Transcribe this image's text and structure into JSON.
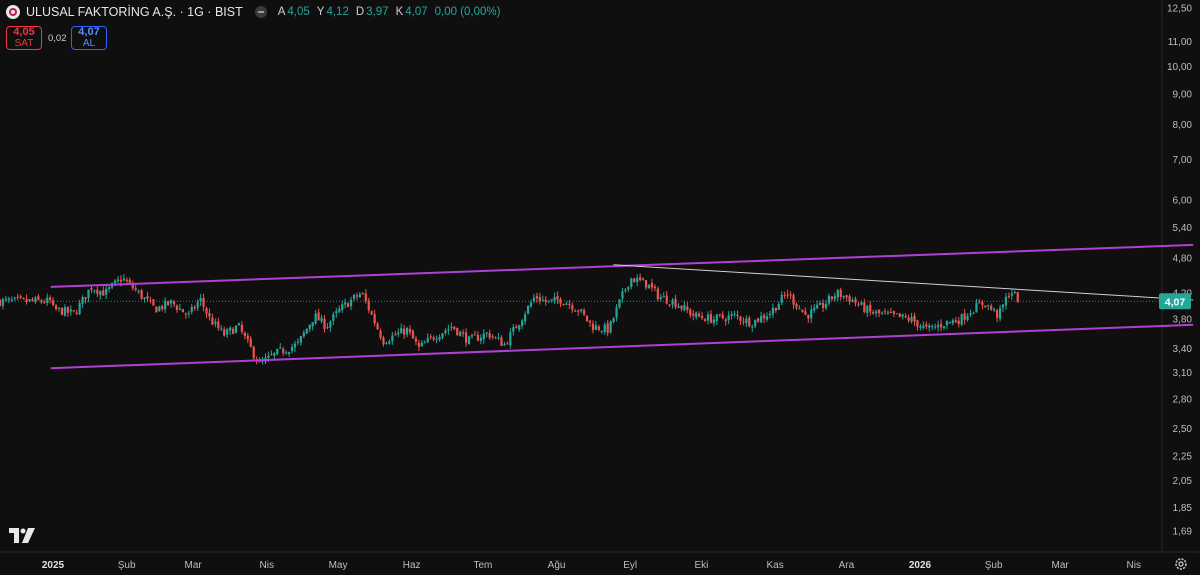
{
  "header": {
    "symbol_title": "ULUSAL FAKTORİNG A.Ş. · 1G · BIST",
    "open_label": "A",
    "open_value": "4,05",
    "high_label": "Y",
    "high_value": "4,12",
    "low_label": "D",
    "low_value": "3,97",
    "close_label": "K",
    "close_value": "4,07",
    "change": "0,00 (0,00%)"
  },
  "trade": {
    "sell_price": "4,05",
    "sell_label": "SAT",
    "spread": "0,02",
    "buy_price": "4,07",
    "buy_label": "AL"
  },
  "colors": {
    "background": "#0f0f0f",
    "up": "#26a69a",
    "down": "#ef5350",
    "channel": "#b13fd6",
    "trendline": "#d0d0d0",
    "price_tag": "#26a69a"
  },
  "chart_data": {
    "type": "candlestick",
    "scale": "log",
    "ylim": [
      1.6,
      12.8
    ],
    "y_ticks": [
      "12,50",
      "11,00",
      "10,00",
      "9,00",
      "8,00",
      "7,00",
      "6,00",
      "5,40",
      "4,80",
      "4,20",
      "3,80",
      "3,40",
      "3,10",
      "2,80",
      "2,50",
      "2,25",
      "2,05",
      "1,85",
      "1,69"
    ],
    "x_ticks": [
      "2025",
      "Şub",
      "Mar",
      "Nis",
      "May",
      "Haz",
      "Tem",
      "Ağu",
      "Eyl",
      "Eki",
      "Kas",
      "Ara",
      "2026",
      "Şub",
      "Mar",
      "Nis"
    ],
    "x_ticks_bold": [
      "2025",
      "2026"
    ],
    "last_price": "4,07",
    "last_price_value": 4.07,
    "price_path": [
      [
        "2025-01-01",
        3.95
      ],
      [
        "2025-01-10",
        3.88
      ],
      [
        "2025-01-17",
        4.3
      ],
      [
        "2025-01-23",
        4.2
      ],
      [
        "2025-01-30",
        4.45
      ],
      [
        "2025-02-06",
        4.2
      ],
      [
        "2025-02-13",
        3.95
      ],
      [
        "2025-02-20",
        4.05
      ],
      [
        "2025-02-27",
        3.85
      ],
      [
        "2025-03-04",
        4.1
      ],
      [
        "2025-03-08",
        3.8
      ],
      [
        "2025-03-14",
        3.58
      ],
      [
        "2025-03-20",
        3.7
      ],
      [
        "2025-03-26",
        3.35
      ],
      [
        "2025-03-29",
        3.2
      ],
      [
        "2025-04-06",
        3.35
      ],
      [
        "2025-04-14",
        3.45
      ],
      [
        "2025-04-21",
        3.85
      ],
      [
        "2025-04-26",
        3.7
      ],
      [
        "2025-05-02",
        3.95
      ],
      [
        "2025-05-07",
        4.1
      ],
      [
        "2025-05-11",
        4.2
      ],
      [
        "2025-05-20",
        3.5
      ],
      [
        "2025-05-30",
        3.65
      ],
      [
        "2025-06-04",
        3.4
      ],
      [
        "2025-06-10",
        3.55
      ],
      [
        "2025-06-18",
        3.7
      ],
      [
        "2025-06-25",
        3.5
      ],
      [
        "2025-07-03",
        3.6
      ],
      [
        "2025-07-10",
        3.45
      ],
      [
        "2025-07-16",
        3.75
      ],
      [
        "2025-07-23",
        4.15
      ],
      [
        "2025-07-28",
        4.05
      ],
      [
        "2025-08-03",
        4.1
      ],
      [
        "2025-08-10",
        3.95
      ],
      [
        "2025-08-16",
        3.7
      ],
      [
        "2025-08-23",
        3.65
      ],
      [
        "2025-08-28",
        4.1
      ],
      [
        "2025-09-01",
        4.45
      ],
      [
        "2025-09-08",
        4.35
      ],
      [
        "2025-09-13",
        4.15
      ],
      [
        "2025-09-20",
        4.05
      ],
      [
        "2025-09-28",
        3.85
      ],
      [
        "2025-10-06",
        3.8
      ],
      [
        "2025-10-15",
        3.85
      ],
      [
        "2025-10-22",
        3.75
      ],
      [
        "2025-10-30",
        3.9
      ],
      [
        "2025-11-06",
        4.2
      ],
      [
        "2025-11-14",
        3.85
      ],
      [
        "2025-11-21",
        4.0
      ],
      [
        "2025-11-27",
        4.2
      ],
      [
        "2025-12-03",
        4.1
      ],
      [
        "2025-12-11",
        3.9
      ],
      [
        "2025-12-20",
        3.85
      ],
      [
        "2025-12-28",
        3.8
      ],
      [
        "2026-01-04",
        3.65
      ],
      [
        "2026-01-12",
        3.75
      ],
      [
        "2026-01-18",
        3.8
      ],
      [
        "2026-01-23",
        3.95
      ],
      [
        "2026-01-28",
        4.05
      ],
      [
        "2026-02-03",
        3.85
      ],
      [
        "2026-02-08",
        4.25
      ],
      [
        "2026-02-12",
        4.07
      ]
    ],
    "drawings": [
      {
        "name": "channel-upper",
        "from": [
          "2024-12-31",
          4.3
        ],
        "to": [
          "2026-04-26",
          5.05
        ]
      },
      {
        "name": "channel-lower",
        "from": [
          "2024-12-31",
          3.15
        ],
        "to": [
          "2026-04-26",
          3.72
        ]
      },
      {
        "name": "trendline",
        "from": [
          "2025-08-25",
          4.68
        ],
        "to": [
          "2026-04-26",
          4.09
        ]
      }
    ]
  }
}
